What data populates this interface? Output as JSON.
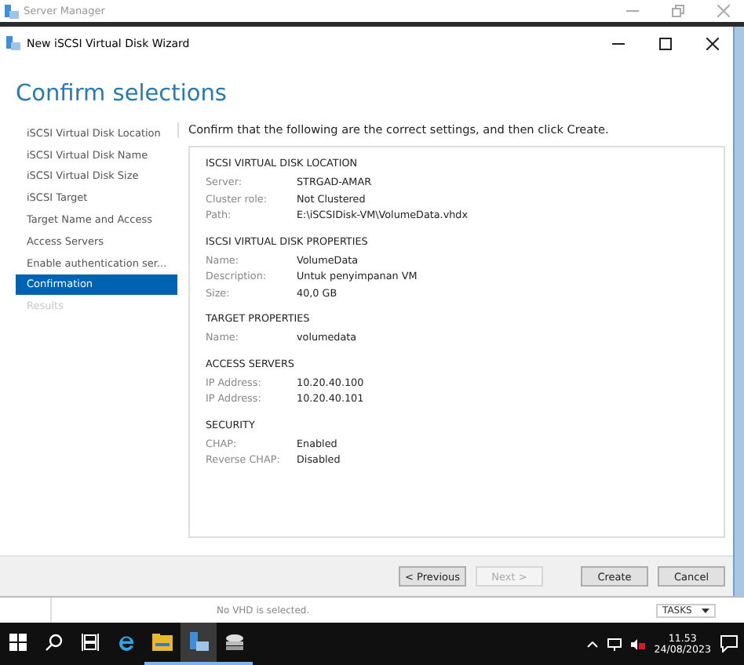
{
  "server_manager": {
    "title": "Server Manager"
  },
  "wizard": {
    "title": "New iSCSI Virtual Disk Wizard",
    "heading": "Confirm selections",
    "nav": [
      {
        "label": "iSCSI Virtual Disk Location",
        "selected": false,
        "disabled": false
      },
      {
        "label": "iSCSI Virtual Disk Name",
        "selected": false,
        "disabled": false
      },
      {
        "label": "iSCSI Virtual Disk Size",
        "selected": false,
        "disabled": false
      },
      {
        "label": "iSCSI Target",
        "selected": false,
        "disabled": false
      },
      {
        "label": "Target Name and Access",
        "selected": false,
        "disabled": false
      },
      {
        "label": "Access Servers",
        "selected": false,
        "disabled": false
      },
      {
        "label": "Enable authentication ser...",
        "selected": false,
        "disabled": false
      },
      {
        "label": "Confirmation",
        "selected": true,
        "disabled": false
      },
      {
        "label": "Results",
        "selected": false,
        "disabled": true
      }
    ],
    "intro": "Confirm that the following are the correct settings, and then click Create.",
    "sections": [
      {
        "title": "ISCSI VIRTUAL DISK LOCATION",
        "rows": [
          {
            "label": "Server:",
            "value": "STRGAD-AMAR"
          },
          {
            "label": "Cluster role:",
            "value": "Not Clustered"
          },
          {
            "label": "Path:",
            "value": "E:\\iSCSIDisk-VM\\VolumeData.vhdx"
          }
        ]
      },
      {
        "title": "ISCSI VIRTUAL DISK PROPERTIES",
        "rows": [
          {
            "label": "Name:",
            "value": "VolumeData"
          },
          {
            "label": "Description:",
            "value": "Untuk penyimpanan VM"
          },
          {
            "label": "Size:",
            "value": "40,0 GB"
          }
        ]
      },
      {
        "title": "TARGET PROPERTIES",
        "rows": [
          {
            "label": "Name:",
            "value": "volumedata"
          }
        ]
      },
      {
        "title": "ACCESS SERVERS",
        "rows": [
          {
            "label": "IP Address:",
            "value": "10.20.40.100"
          },
          {
            "label": "IP Address:",
            "value": "10.20.40.101"
          }
        ]
      },
      {
        "title": "SECURITY",
        "rows": [
          {
            "label": "CHAP:",
            "value": "Enabled"
          },
          {
            "label": "Reverse CHAP:",
            "value": "Disabled"
          }
        ]
      }
    ],
    "buttons": [
      {
        "label": "< Previous",
        "disabled": false
      },
      {
        "label": "Next >",
        "disabled": true
      },
      {
        "label": "Create",
        "disabled": false
      },
      {
        "label": "Cancel",
        "disabled": false
      }
    ]
  },
  "background": {
    "status": "No VHD is selected.",
    "tasks": "TASKS"
  },
  "taskbar": {
    "apps": [
      {
        "kind": "start",
        "running": false,
        "selected": false
      },
      {
        "kind": "search",
        "running": false,
        "selected": false
      },
      {
        "kind": "taskview",
        "running": false,
        "selected": false
      },
      {
        "kind": "browser",
        "running": false,
        "selected": false
      },
      {
        "kind": "folder",
        "running": true,
        "selected": false
      },
      {
        "kind": "server",
        "running": true,
        "selected": true
      },
      {
        "kind": "storage",
        "running": true,
        "selected": false
      }
    ],
    "time": "11.53",
    "date": "24/08/2023"
  }
}
